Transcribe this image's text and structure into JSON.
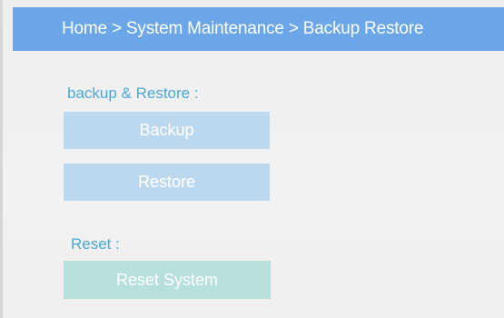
{
  "header": {
    "breadcrumb": "Home > System Maintenance > Backup Restore"
  },
  "backup_section": {
    "title": "backup & Restore :",
    "backup_label": "Backup",
    "restore_label": "Restore"
  },
  "reset_section": {
    "title": "Reset :",
    "reset_label": "Reset System"
  },
  "colors": {
    "header_background": "#6aa6e8",
    "section_title": "#4aa8d8",
    "backup_button": "#bcd8ef",
    "reset_button": "#b7e0dc"
  }
}
